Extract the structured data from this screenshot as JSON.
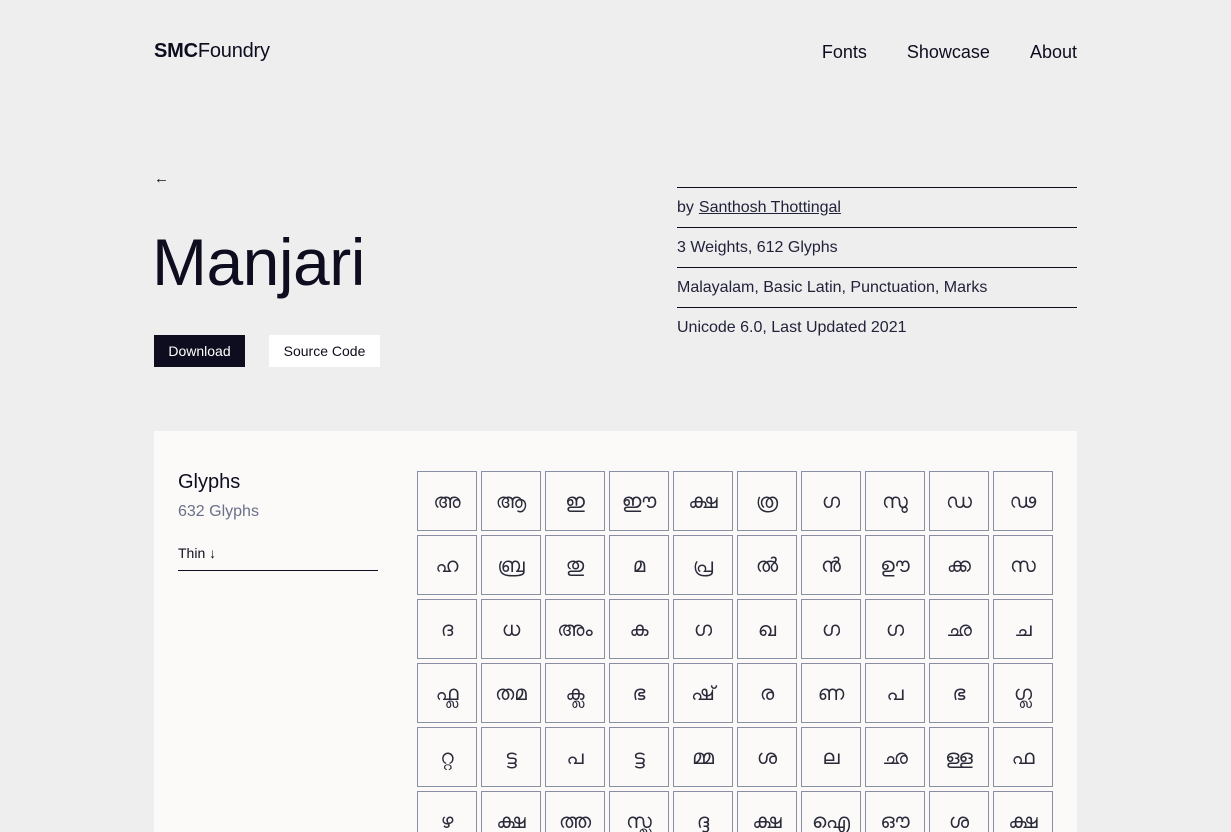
{
  "header": {
    "logo_bold": "SMC",
    "logo_rest": "Foundry",
    "nav": [
      "Fonts",
      "Showcase",
      "About"
    ]
  },
  "font": {
    "back_icon": "←",
    "name": "Manjari",
    "download_label": "Download",
    "source_label": "Source Code"
  },
  "meta": {
    "by_prefix": "by",
    "author": "Santhosh Thottingal",
    "weights": "3 Weights, 612 Glyphs",
    "scripts": "Malayalam, Basic Latin, Punctuation, Marks",
    "unicode": "Unicode 6.0, Last Updated 2021"
  },
  "glyph_panel": {
    "title": "Glyphs",
    "count": "632 Glyphs",
    "weight": "Thin ↓"
  },
  "glyphs": [
    "അ",
    "ആ",
    "ഇ",
    "ഈ",
    "ക്ഷ",
    "ത്ര",
    "ഗ",
    "സു",
    "ഡ",
    "ഢ",
    "ഹ",
    "ബ്ര",
    "തു",
    "മ",
    "പ്ര",
    "ൽ",
    "ൻ",
    "ഊ",
    "ക്ക",
    "സ",
    "ദ",
    "ധ",
    "അം",
    "ക",
    "ഗ",
    "ഖ",
    "ഗ",
    "ഗ",
    "ഛ",
    "ച",
    "ഫ്ല",
    "തമ",
    "ക്ല",
    "ഭ",
    "ഷ്",
    "ര",
    "ണ",
    "പ",
    "ഭ",
    "ഗ്ല",
    "റ്റ",
    "ട്ട",
    "പ",
    "ട്ട",
    "മ്മ",
    "ശ",
    "ല",
    "ഛ",
    "ള്ള",
    "ഫ",
    "ഴ",
    "ക്ഷ",
    "ത്ത",
    "സ്ല",
    "ദ്ദ",
    "ക്ഷ",
    "ഐ",
    "ഔ",
    "ശ",
    "ക്ഷ"
  ],
  "colors": {
    "background": "#eeeeee",
    "panel": "#fbfaf8",
    "ink": "#0d0d1f",
    "muted": "#6a7088"
  }
}
